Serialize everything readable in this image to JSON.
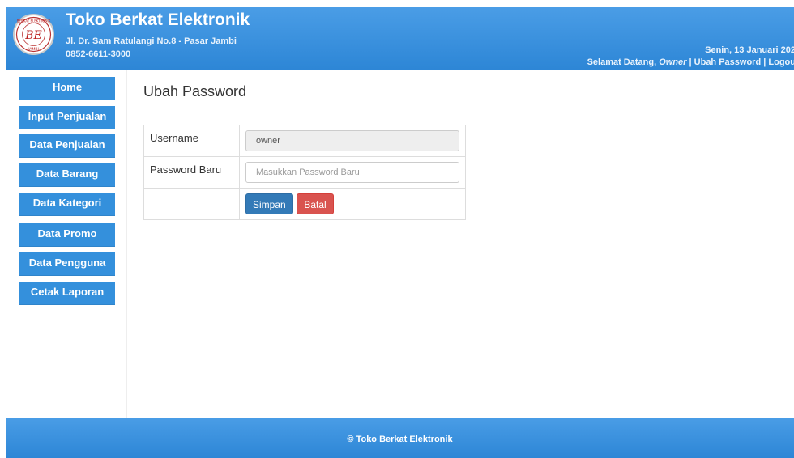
{
  "header": {
    "store_name": "Toko Berkat Elektronik",
    "address": "Jl. Dr. Sam Ratulangi No.8 - Pasar Jambi",
    "phone": "0852-6611-3000",
    "date": "Senin, 13 Januari 202",
    "welcome": "Selamat Datang,",
    "user": "Owner",
    "separator": "|",
    "change_password_link": "Ubah Password",
    "logout_link": "Logou",
    "logo": {
      "initials": "BE",
      "ring_text": "BERKAT ELEKTRONIK",
      "city": "JAMBI"
    }
  },
  "sidebar": {
    "items": [
      {
        "label": "Home"
      },
      {
        "label": "Input Penjualan"
      },
      {
        "label": "Data Penjualan"
      },
      {
        "label": "Data Barang"
      },
      {
        "label": "Data Kategori"
      },
      {
        "label": "Data Promo"
      },
      {
        "label": "Data Pengguna"
      },
      {
        "label": "Cetak Laporan"
      }
    ]
  },
  "main": {
    "title": "Ubah Password",
    "form": {
      "username_label": "Username",
      "username_value": "owner",
      "password_label": "Password Baru",
      "password_placeholder": "Masukkan Password Baru",
      "save_button": "Simpan",
      "cancel_button": "Batal"
    }
  },
  "footer": {
    "text": "© Toko Berkat Elektronik"
  },
  "colors": {
    "header_blue": "#3a92e0",
    "nav_blue": "#3490dc",
    "primary": "#337ab7",
    "danger": "#d9534f"
  }
}
